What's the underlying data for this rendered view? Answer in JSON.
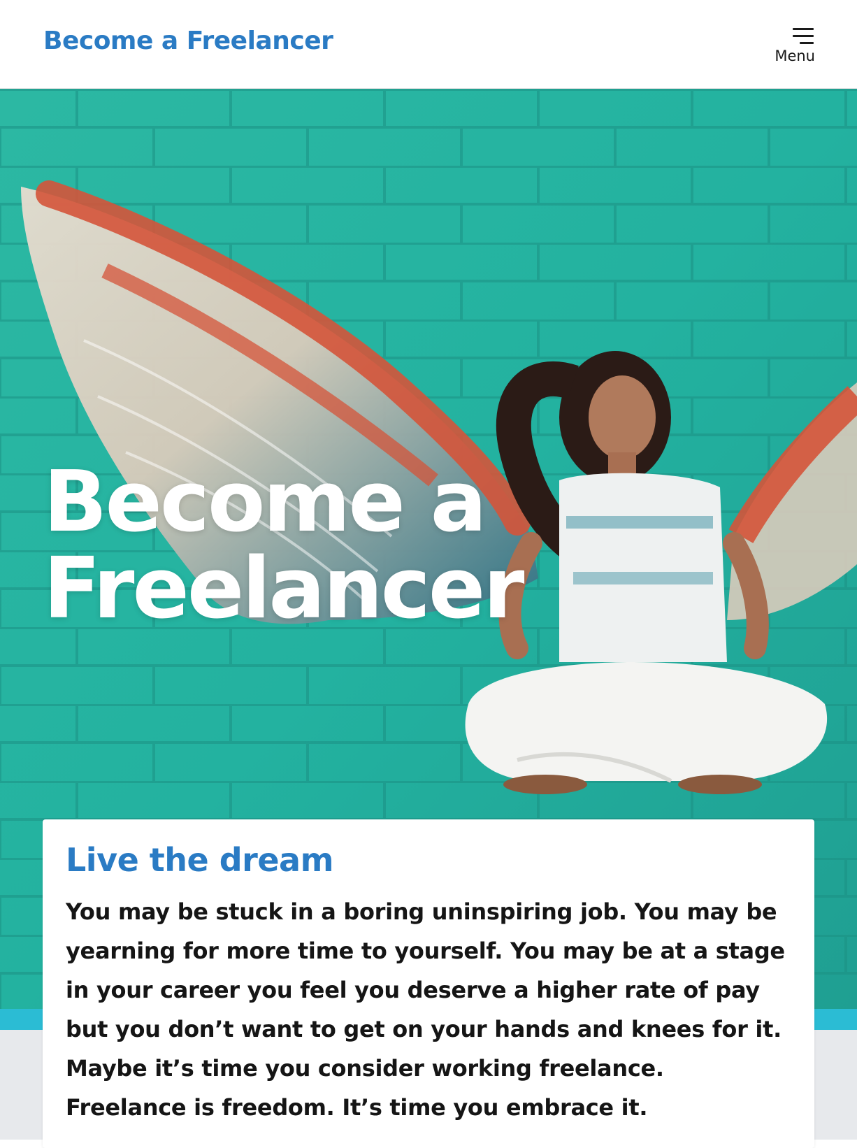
{
  "header": {
    "site_title": "Become a Freelancer",
    "menu_label": "Menu",
    "menu_icon": "hamburger-icon"
  },
  "hero": {
    "title": "Become a Freelancer",
    "image_description_icon": "hero-photo"
  },
  "intro": {
    "heading": "Live the dream",
    "body": "You may be stuck in a boring uninspiring job. You may be yearning for more time to yourself. You may be at a stage in your career you feel you deserve a higher rate of pay but you don’t want to get on your hands and knees for it. Maybe it’s time you consider working freelance. Freelance is freedom. It’s time you embrace it."
  },
  "colors": {
    "brand_blue": "#2a7bc4",
    "hero_teal": "#2fbaa6",
    "accent_cyan": "#2bbcd4",
    "wing_red": "#d4543a"
  }
}
